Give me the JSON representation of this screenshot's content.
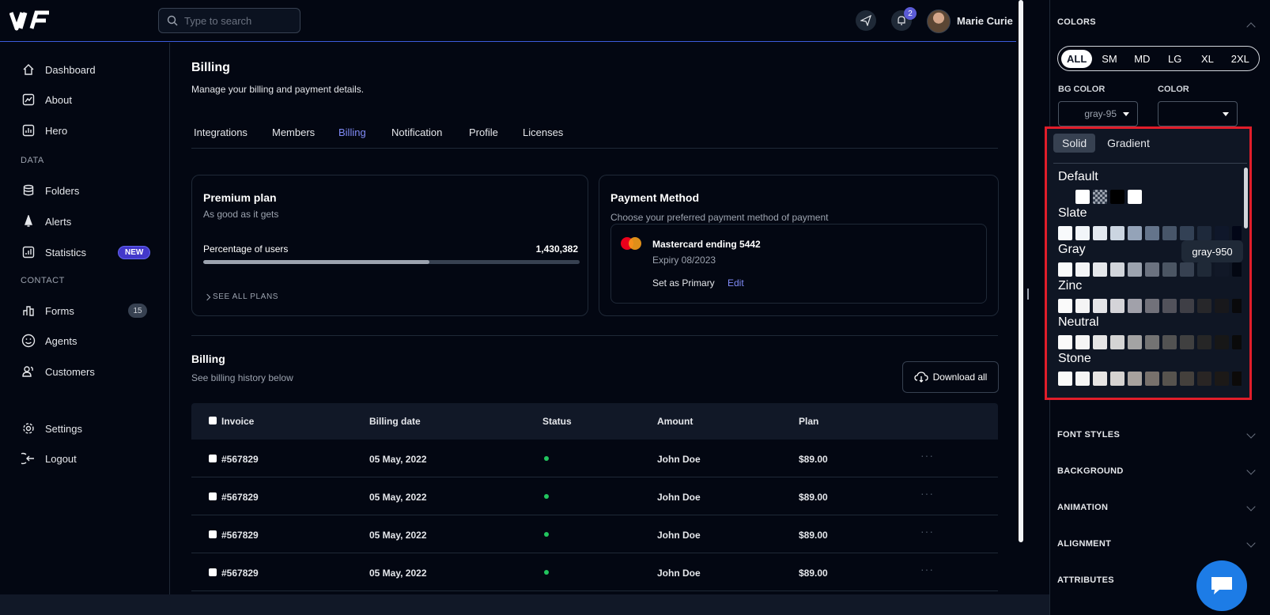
{
  "search": {
    "placeholder": "Type to search"
  },
  "header": {
    "notification_count": "2",
    "user_name": "Marie Curie"
  },
  "sidebar": {
    "items": [
      {
        "label": "Dashboard"
      },
      {
        "label": "About"
      },
      {
        "label": "Hero"
      },
      {
        "label": "Folders"
      },
      {
        "label": "Alerts"
      },
      {
        "label": "Statistics",
        "badge": "NEW"
      },
      {
        "label": "Forms",
        "badge": "15"
      },
      {
        "label": "Agents"
      },
      {
        "label": "Customers"
      },
      {
        "label": "Settings"
      },
      {
        "label": "Logout"
      }
    ],
    "sections": {
      "data": "DATA",
      "contact": "CONTACT"
    }
  },
  "page": {
    "title": "Billing",
    "subtitle": "Manage your billing and payment details.",
    "tabs": [
      "Integrations",
      "Members",
      "Billing",
      "Notification",
      "Profile",
      "Licenses"
    ],
    "active_tab": "Billing"
  },
  "plan_card": {
    "title": "Premium plan",
    "subtitle": "As good as it gets",
    "metric_label": "Percentage of users",
    "metric_value": "1,430,382",
    "progress_fraction": 0.6,
    "see_all": "SEE ALL PLANS"
  },
  "payment_card": {
    "title": "Payment Method",
    "subtitle": "Choose your preferred payment method of payment",
    "card_name": "Mastercard ending 5442",
    "expiry": "Expiry 08/2023",
    "set_primary": "Set as Primary",
    "edit": "Edit"
  },
  "history": {
    "title": "Billing",
    "subtitle": "See billing history below",
    "download": "Download all",
    "columns": [
      "Invoice",
      "Billing date",
      "Status",
      "Amount",
      "Plan"
    ],
    "rows": [
      {
        "invoice": "#567829",
        "date": "05 May, 2022",
        "status": "active",
        "amount": "John Doe",
        "plan": "$89.00"
      },
      {
        "invoice": "#567829",
        "date": "05 May, 2022",
        "status": "active",
        "amount": "John Doe",
        "plan": "$89.00"
      },
      {
        "invoice": "#567829",
        "date": "05 May, 2022",
        "status": "active",
        "amount": "John Doe",
        "plan": "$89.00"
      },
      {
        "invoice": "#567829",
        "date": "05 May, 2022",
        "status": "active",
        "amount": "John Doe",
        "plan": "$89.00"
      }
    ]
  },
  "panel": {
    "colors_heading": "COLORS",
    "sizes": [
      "ALL",
      "SM",
      "MD",
      "LG",
      "XL",
      "2XL"
    ],
    "active_size": "ALL",
    "bg_color_label": "BG COLOR",
    "bg_color_value": "gray-95",
    "color_label": "COLOR",
    "picker_tabs": [
      "Solid",
      "Gradient"
    ],
    "tooltip": "gray-950",
    "sections": [
      "FONT STYLES",
      "BACKGROUND",
      "ANIMATION",
      "ALIGNMENT",
      "ATTRIBUTES"
    ]
  },
  "palette": [
    {
      "name": "Default",
      "colors": [
        "#0f1624",
        "#ffffff",
        "checker",
        "#000000",
        "#ffffff"
      ]
    },
    {
      "name": "Slate",
      "colors": [
        "#f8fafc",
        "#f1f5f9",
        "#e2e8f0",
        "#cbd5e1",
        "#94a3b8",
        "#64748b",
        "#475569",
        "#334155",
        "#1e293b",
        "#0f172a",
        "#020617"
      ]
    },
    {
      "name": "Gray",
      "colors": [
        "#f9fafb",
        "#f3f4f6",
        "#e5e7eb",
        "#d1d5db",
        "#9ca3af",
        "#6b7280",
        "#4b5563",
        "#374151",
        "#1f2937",
        "#111827",
        "#030712"
      ]
    },
    {
      "name": "Zinc",
      "colors": [
        "#fafafa",
        "#f4f4f5",
        "#e4e4e7",
        "#d4d4d8",
        "#a1a1aa",
        "#71717a",
        "#52525b",
        "#3f3f46",
        "#27272a",
        "#18181b",
        "#09090b"
      ]
    },
    {
      "name": "Neutral",
      "colors": [
        "#fafafa",
        "#f5f5f5",
        "#e5e5e5",
        "#d4d4d4",
        "#a3a3a3",
        "#737373",
        "#525252",
        "#404040",
        "#262626",
        "#171717",
        "#0a0a0a"
      ]
    },
    {
      "name": "Stone",
      "colors": [
        "#fafaf9",
        "#f5f5f4",
        "#e7e5e4",
        "#d6d3d1",
        "#a8a29e",
        "#78716c",
        "#57534e",
        "#44403c",
        "#292524",
        "#1c1917",
        "#0c0a09"
      ]
    }
  ],
  "theme": {
    "accent": "#818cf8",
    "status_green": "#22c55e",
    "highlight_red": "#e11d2a"
  }
}
